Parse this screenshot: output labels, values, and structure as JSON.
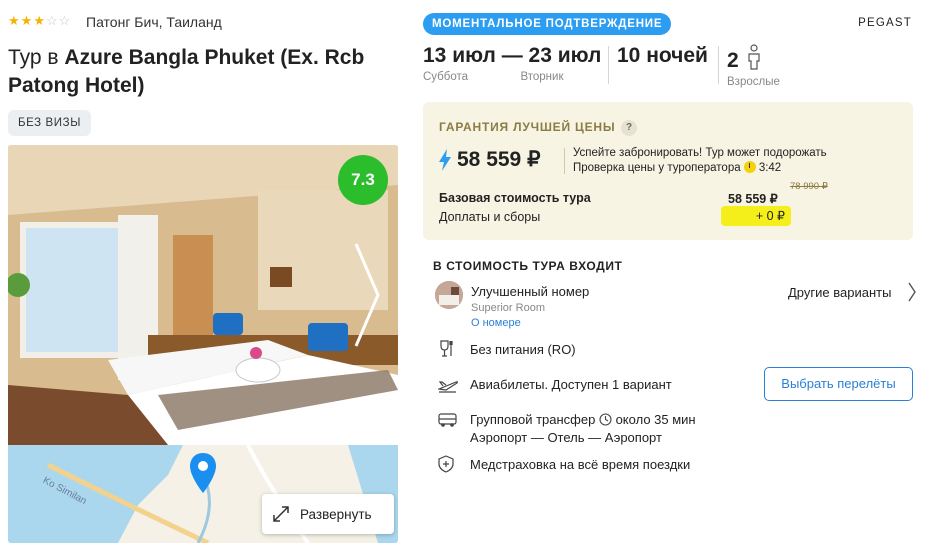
{
  "hotel": {
    "stars": 3,
    "stars_max": 5,
    "location": "Патонг Бич, Таиланд",
    "title_prefix": "Тур в ",
    "title_name": "Azure Bangla Phuket (Ex. Rcb Patong Hotel)",
    "visa_badge": "БЕЗ ВИЗЫ",
    "rating": "7.3",
    "rating_color": "#2bbd2b"
  },
  "map": {
    "road_label": "Ko Similan",
    "expand_label": "Развернуть"
  },
  "header": {
    "instant_badge": "МОМЕНТАЛЬНОЕ ПОДТВЕРЖДЕНИЕ",
    "operator": "PEGAST",
    "dates": "13 июл — 23 июл",
    "date_from_day": "Суббота",
    "date_to_day": "Вторник",
    "nights": "10 ночей",
    "adults_count": "2",
    "adults_label": "Взрослые"
  },
  "price": {
    "guarantee_label": "ГАРАНТИЯ ЛУЧШЕЙ ЦЕНЫ",
    "help_label": "?",
    "total": "58 559 ₽",
    "hurry_line1": "Успейте забронировать! Тур может подорожать",
    "hurry_line2": "Проверка цены у туроператора",
    "timer": "3:42",
    "base_label": "Базовая стоимость тура",
    "base_value": "58 559 ₽",
    "old_value": "78 990 ₽",
    "fees_label": "Доплаты и сборы",
    "fees_value": "+ 0 ₽"
  },
  "included": {
    "title": "В СТОИМОСТЬ ТУРА ВХОДИТ",
    "room_name": "Улучшенный номер",
    "room_type": "Superior Room",
    "room_link": "О номере",
    "other_variants": "Другие варианты",
    "meal": "Без питания (RO)",
    "flights": "Авиабилеты. Доступен 1 вариант",
    "flights_button": "Выбрать перелёты",
    "transfer": "Групповой трансфер",
    "transfer_time": "около 35 мин",
    "transfer_route": "Аэропорт — Отель — Аэропорт",
    "insurance": "Медстраховка на всё время поездки"
  },
  "icons": {
    "star": "star-icon",
    "pin": "map-pin-icon",
    "expand": "expand-icon",
    "person": "person-icon",
    "bolt": "lightning-icon",
    "timer": "timer-icon",
    "meal": "wine-glass-icon",
    "plane": "airplane-icon",
    "bus": "bus-icon",
    "clock": "clock-icon",
    "shield": "shield-plus-icon",
    "chevron": "chevron-right-icon"
  },
  "colors": {
    "accent_blue": "#2c9df0",
    "link_blue": "#2c7fd6",
    "price_panel": "#f7f4e3",
    "highlight_yellow": "#f4ee1a"
  }
}
